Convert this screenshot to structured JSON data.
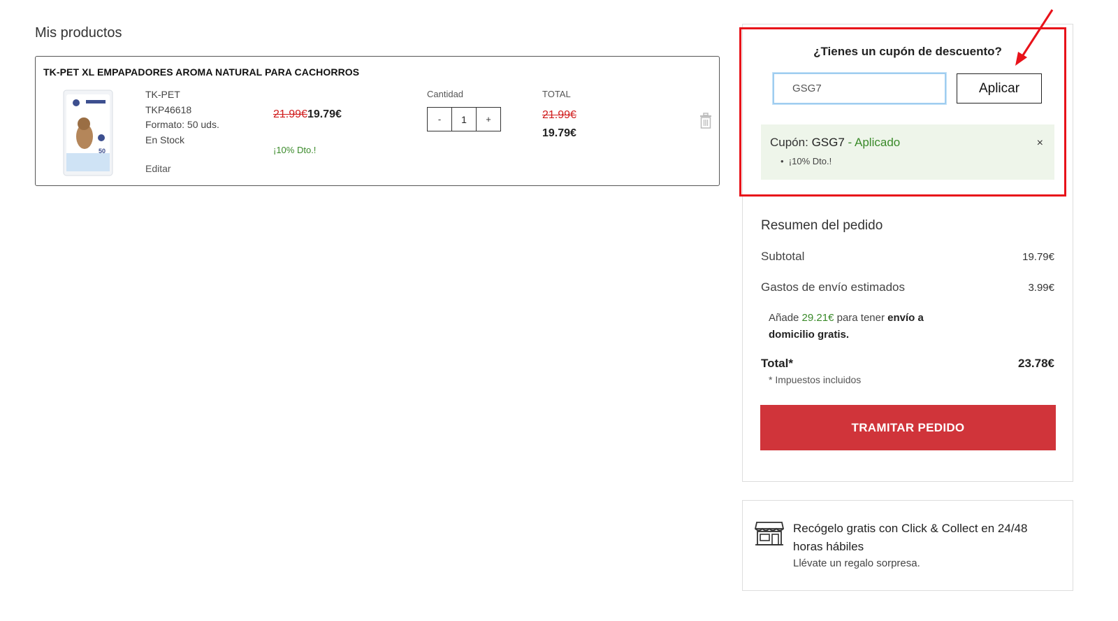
{
  "cart": {
    "section_title": "Mis productos",
    "product": {
      "name": "TK-PET XL EMPAPADORES AROMA NATURAL PARA CACHORROS",
      "brand": "TK-PET",
      "sku": "TKP46618",
      "format": "Formato: 50 uds.",
      "stock": "En Stock",
      "edit_label": "Editar",
      "old_price": "21.99€",
      "new_price": "19.79€",
      "discount_label": "¡10% Dto.!",
      "quantity_label": "Cantidad",
      "quantity_minus": "-",
      "quantity_value": "1",
      "quantity_plus": "+",
      "total_label": "TOTAL",
      "total_old": "21.99€",
      "total_new": "19.79€",
      "image_icon": "product-package-image"
    }
  },
  "coupon": {
    "title": "¿Tienes un cupón de descuento?",
    "input_value": "GSG7",
    "apply_label": "Aplicar",
    "applied_prefix": "Cupón:",
    "applied_code": "GSG7",
    "applied_separator": "-",
    "applied_status": "Aplicado",
    "applied_detail": "¡10% Dto.!",
    "remove_label": "×"
  },
  "summary": {
    "title": "Resumen del pedido",
    "subtotal_label": "Subtotal",
    "subtotal_value": "19.79€",
    "shipping_label": "Gastos de envío estimados",
    "shipping_value": "3.99€",
    "free_shipping_prefix": "Añade",
    "free_shipping_amount": "29.21€",
    "free_shipping_middle": "para tener",
    "free_shipping_bold": "envío a domicilio gratis.",
    "total_label": "Total*",
    "total_value": "23.78€",
    "tax_note": "* Impuestos incluidos",
    "checkout_label": "TRAMITAR PEDIDO"
  },
  "click_collect": {
    "title": "Recógelo gratis con Click & Collect en 24/48 horas hábiles",
    "subtitle": "Llévate un regalo sorpresa.",
    "icon": "store-icon"
  },
  "colors": {
    "accent_red": "#d0343a",
    "highlight_red": "#e8121a",
    "success_green": "#3a8a2a",
    "strike_red": "#d01c1c"
  }
}
